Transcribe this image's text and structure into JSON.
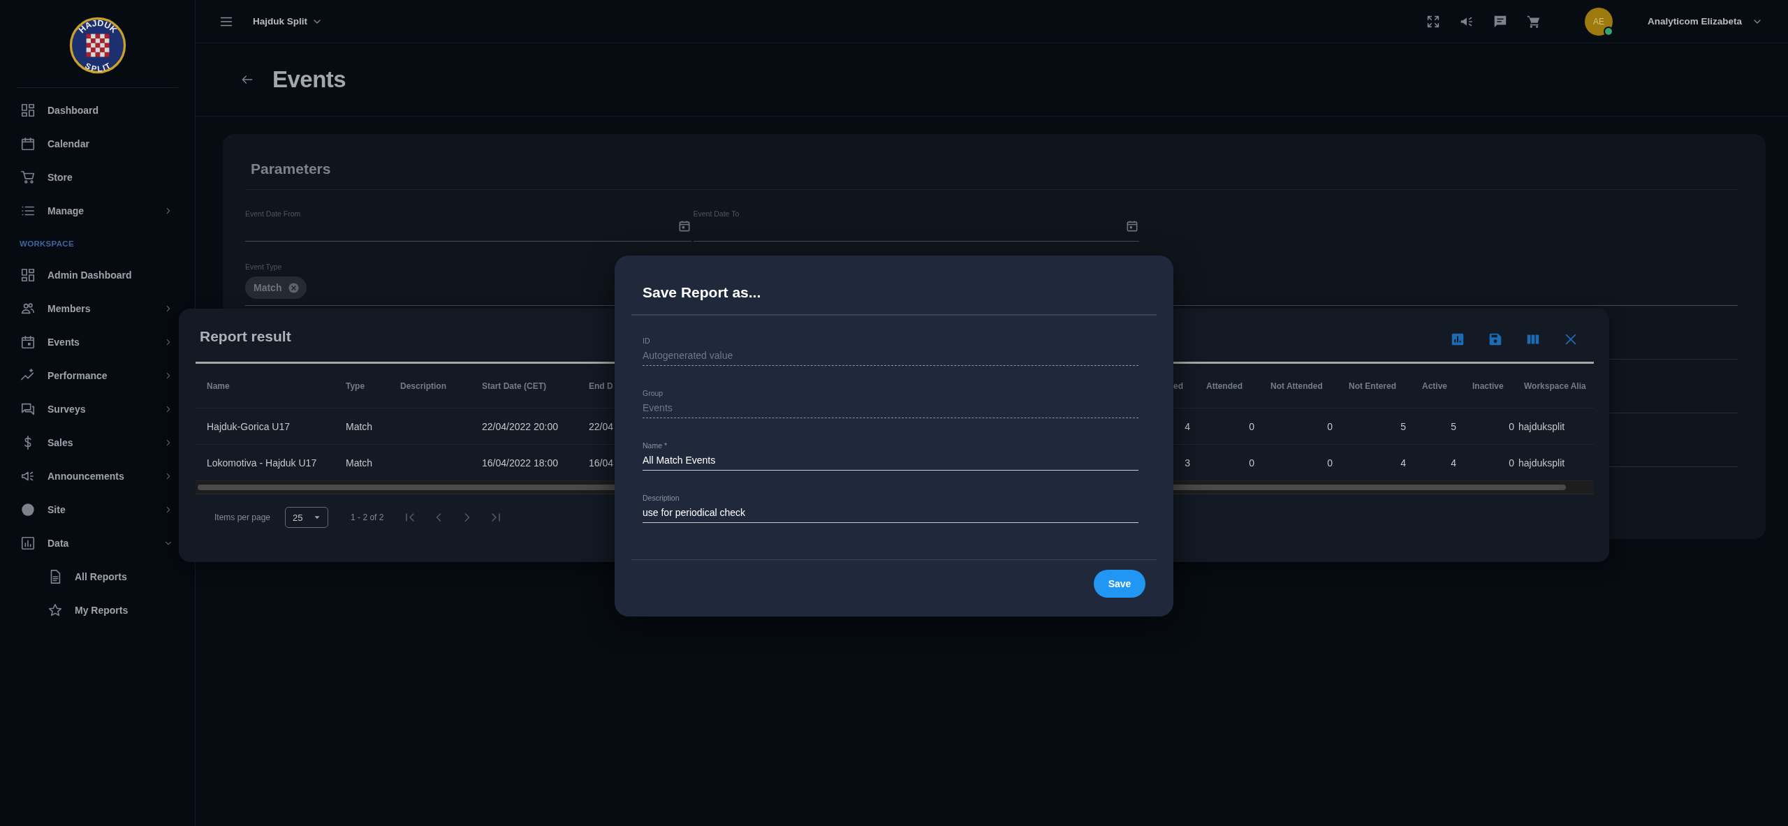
{
  "logo": {
    "top_text": "HAJDUK",
    "bottom_text": "SPLIT"
  },
  "sidebar": {
    "items": [
      {
        "label": "Dashboard"
      },
      {
        "label": "Calendar"
      },
      {
        "label": "Store"
      },
      {
        "label": "Manage",
        "expanded": false
      }
    ],
    "section": "WORKSPACE",
    "workspace_items": [
      {
        "label": "Admin Dashboard"
      },
      {
        "label": "Members",
        "expanded": false
      },
      {
        "label": "Events",
        "expanded": false
      },
      {
        "label": "Performance",
        "expanded": false
      },
      {
        "label": "Surveys",
        "expanded": false
      },
      {
        "label": "Sales",
        "expanded": false
      },
      {
        "label": "Announcements",
        "expanded": false
      },
      {
        "label": "Site",
        "expanded": false
      },
      {
        "label": "Data",
        "expanded": true,
        "children": [
          {
            "label": "All Reports"
          },
          {
            "label": "My Reports"
          }
        ]
      }
    ]
  },
  "top_bar": {
    "workspace": "Hajduk Split",
    "avatar_initials": "AE",
    "online": true,
    "user": "Analyticom Elizabeta"
  },
  "page": {
    "title": "Events"
  },
  "parameters": {
    "title": "Parameters",
    "date_fields": [
      {
        "label": "Event Date From"
      },
      {
        "label": "Event Date To"
      }
    ],
    "event_type": {
      "label": "Event Type",
      "chips": [
        "Match"
      ]
    }
  },
  "report": {
    "title": "Report result",
    "left_columns": [
      {
        "label": "Name"
      },
      {
        "label": "Type"
      },
      {
        "label": "Description"
      },
      {
        "label": "Start Date (CET)"
      },
      {
        "label": "End D"
      }
    ],
    "right_columns": [
      {
        "label": "ed",
        "kind": "number"
      },
      {
        "label": "Attended",
        "kind": "number"
      },
      {
        "label": "Not Attended",
        "kind": "number"
      },
      {
        "label": "Not Entered",
        "kind": "number"
      },
      {
        "label": "Active",
        "kind": "number"
      },
      {
        "label": "Inactive",
        "kind": "number"
      },
      {
        "label": "Workspace Alia",
        "kind": "text"
      }
    ],
    "rows": [
      {
        "left_cells": [
          "Hajduk-Gorica U17",
          "Match",
          "",
          "22/04/2022 20:00",
          "22/04"
        ],
        "right_cells": [
          "4",
          "0",
          "0",
          "5",
          "5",
          "0",
          "hajduksplit"
        ]
      },
      {
        "left_cells": [
          "Lokomotiva - Hajduk U17",
          "Match",
          "",
          "16/04/2022 18:00",
          "16/04"
        ],
        "right_cells": [
          "3",
          "0",
          "0",
          "4",
          "4",
          "0",
          "hajduksplit"
        ]
      }
    ],
    "pagination": {
      "label": "Items per page",
      "page_size": "25",
      "range": "1 - 2 of 2"
    }
  },
  "dialog": {
    "title": "Save Report as...",
    "fields": [
      {
        "label": "ID",
        "placeholder": "Autogenerated value",
        "disabled": true
      },
      {
        "label": "Group",
        "placeholder": "Events",
        "disabled": true
      },
      {
        "label": "Name *",
        "value": "All Match Events",
        "disabled": false
      },
      {
        "label": "Description",
        "value": "use for periodical check",
        "disabled": false
      }
    ],
    "button": "Save"
  }
}
